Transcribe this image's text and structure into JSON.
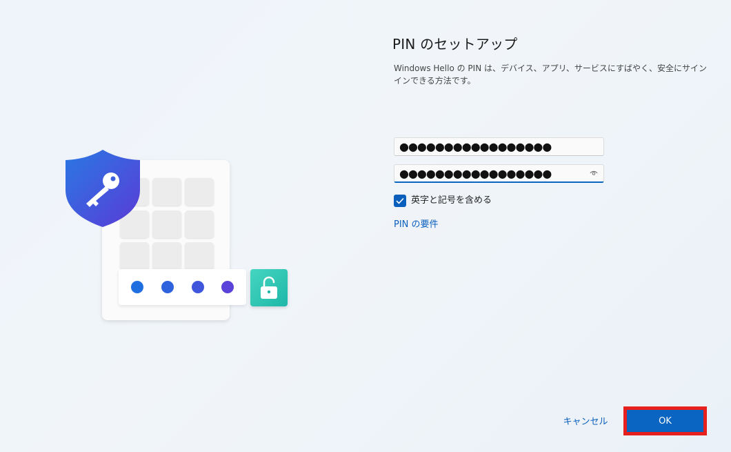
{
  "header": {
    "title": "PIN のセットアップ",
    "description": "Windows Hello の PIN は、デバイス、アプリ、サービスにすばやく、安全にサインインできる方法です。"
  },
  "form": {
    "new_pin_value": "●●●●●●●●●●●●●●●●●",
    "confirm_pin_value": "●●●●●●●●●●●●●●●●●",
    "include_letters_checked": true,
    "include_letters_label": "英字と記号を含める",
    "requirements_link": "PIN の要件"
  },
  "footer": {
    "cancel_label": "キャンセル",
    "ok_label": "OK"
  },
  "colors": {
    "accent": "#0a64c2",
    "highlight_frame": "#e5201f",
    "shield_top": "#2f6ae0",
    "shield_bottom": "#5b3fd8",
    "lock_tile": "#2cc4b1"
  },
  "illustration": {
    "icons": [
      "shield-key-icon",
      "keypad",
      "pin-dots",
      "unlock-icon"
    ]
  }
}
